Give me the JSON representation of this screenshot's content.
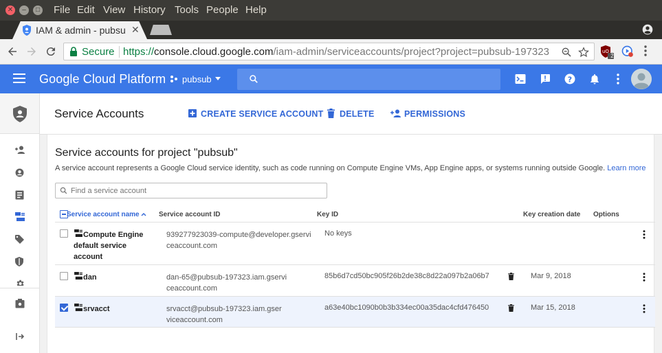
{
  "os_menu": {
    "items": [
      "File",
      "Edit",
      "View",
      "History",
      "Tools",
      "People",
      "Help"
    ]
  },
  "browser": {
    "tab_title": "IAM & admin - pubsub",
    "tab_close": "✕",
    "secure_label": "Secure",
    "url_scheme": "https://",
    "url_host": "console.cloud.google.com",
    "url_path": "/iam-admin/serviceaccounts/project?project=pubsub-197323",
    "extension_badge": "2"
  },
  "gcp": {
    "brand": "Google Cloud Platform",
    "project_name": "pubsub",
    "search_placeholder": ""
  },
  "page": {
    "title": "Service Accounts",
    "actions": {
      "create": "CREATE SERVICE ACCOUNT",
      "delete": "DELETE",
      "permissions": "PERMISSIONS"
    },
    "section_title": "Service accounts for project \"pubsub\"",
    "description": "A service account represents a Google Cloud service identity, such as code running on Compute Engine VMs, App Engine apps, or systems running outside Google.",
    "learn_more": "Learn more",
    "filter_placeholder": "Find a service account"
  },
  "table": {
    "columns": {
      "name": "Service account name",
      "id": "Service account ID",
      "key_id": "Key ID",
      "key_date": "Key creation date",
      "options": "Options"
    },
    "rows": [
      {
        "name": "Compute Engine default service account",
        "id": "939277923039-compute@developer.gserviceaccount.com",
        "key_id": "No keys",
        "key_date": "",
        "selected": false
      },
      {
        "name": "dan",
        "id": "dan-65@pubsub-197323.iam.gserviceaccount.com",
        "key_id": "85b6d7cd50bc905f26b2de38c8d22a097b2a06b7",
        "key_date": "Mar 9, 2018",
        "selected": false
      },
      {
        "name": "srvacct",
        "id": "srvacct@pubsub-197323.iam.gserviceaccount.com",
        "key_id": "a63e40bc1090b0b3b334ec00a35dac4cfd476450",
        "key_date": "Mar 15, 2018",
        "selected": true
      }
    ]
  },
  "colors": {
    "gcp_blue": "#3b78e7",
    "link_blue": "#3367d6",
    "secure_green": "#0b8043",
    "selected_row": "#eef3fd"
  },
  "icons": {
    "rail": [
      "iam-shield-icon",
      "add-person-icon",
      "account-circle-icon",
      "audit-log-icon",
      "service-accounts-icon",
      "labels-icon",
      "security-shield-icon",
      "settings-icon",
      "manage-resources-icon",
      "expand-icon"
    ]
  }
}
